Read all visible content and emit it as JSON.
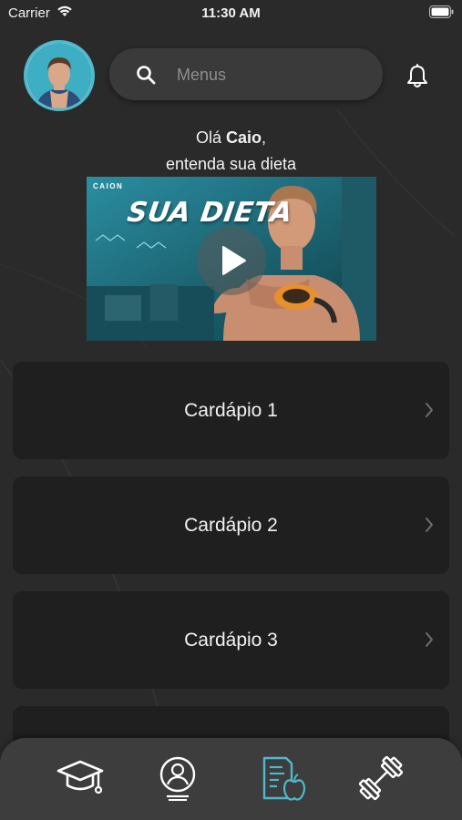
{
  "status_bar": {
    "carrier": "Carrier",
    "time": "11:30 AM",
    "icons": [
      "wifi-icon",
      "battery-icon"
    ]
  },
  "header": {
    "avatar_alt": "avatar",
    "search": {
      "placeholder": "Menus",
      "value": ""
    },
    "icons": [
      "search-icon",
      "bell-icon"
    ]
  },
  "greeting": {
    "prefix": "Olá ",
    "name": "Caio",
    "suffix": ",",
    "line2": "entenda sua dieta"
  },
  "video": {
    "brand": "CAION",
    "title": "SUA DIETA"
  },
  "menus": [
    {
      "label": "Cardápio 1"
    },
    {
      "label": "Cardápio 2"
    },
    {
      "label": "Cardápio 3"
    },
    {
      "label": ""
    }
  ],
  "bottom_nav": {
    "items": [
      {
        "icon": "graduation-cap-icon",
        "active": false
      },
      {
        "icon": "profile-icon",
        "active": false
      },
      {
        "icon": "diet-document-icon",
        "active": true
      },
      {
        "icon": "dumbbell-icon",
        "active": false
      }
    ]
  },
  "colors": {
    "background": "#2a2a2b",
    "card": "#1f1f20",
    "accent": "#4fb8cc",
    "nav": "#3d3d3e"
  }
}
